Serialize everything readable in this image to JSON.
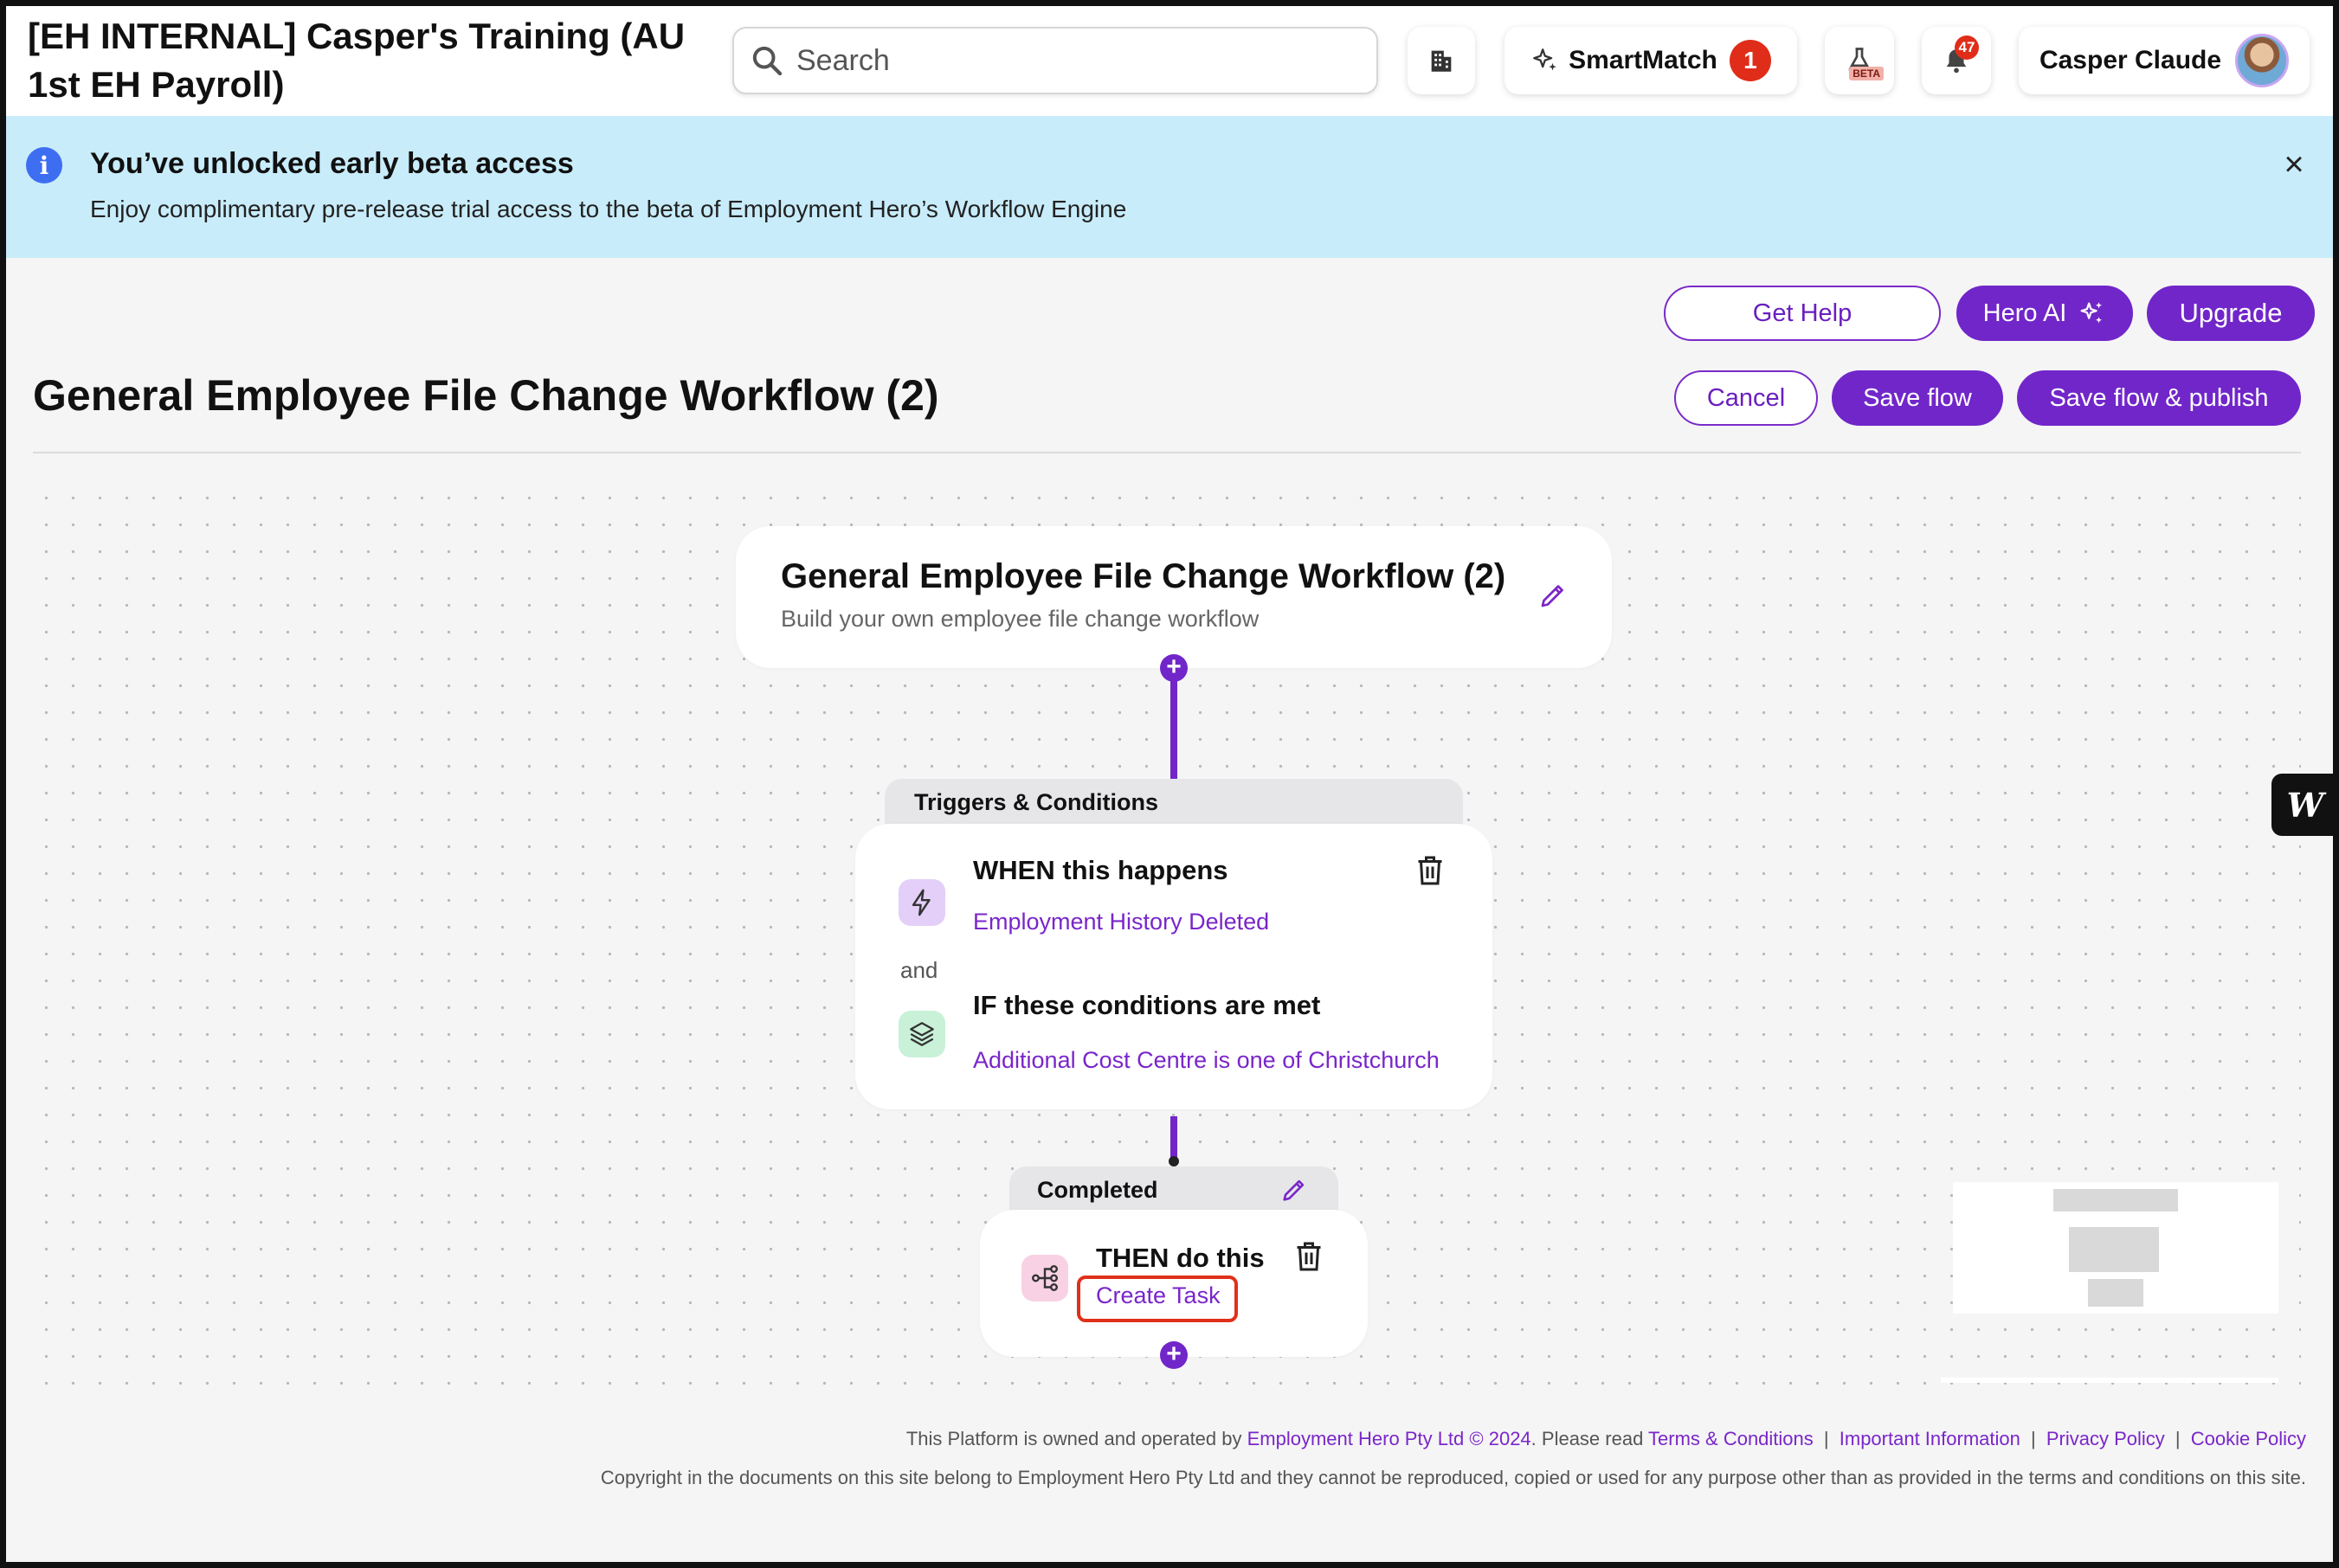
{
  "header": {
    "org_title": "[EH INTERNAL] Casper's Training (AU 1st EH Payroll)",
    "search_placeholder": "Search",
    "smartmatch_label": "SmartMatch",
    "smartmatch_count": "1",
    "beta_tag": "BETA",
    "notification_count": "47",
    "user_name": "Casper Claude"
  },
  "banner": {
    "title": "You’ve unlocked early beta access",
    "text": "Enjoy complimentary pre-release trial access to the beta of Employment Hero’s Workflow Engine",
    "close": "×"
  },
  "actions": {
    "get_help": "Get Help",
    "hero_ai": "Hero AI",
    "upgrade": "Upgrade",
    "cancel": "Cancel",
    "save_flow": "Save flow",
    "save_publish": "Save flow & publish"
  },
  "page": {
    "title": "General Employee File Change Workflow (2)"
  },
  "workflow": {
    "title_card": {
      "title": "General Employee File Change Workflow (2)",
      "subtitle": "Build your own employee file change workflow"
    },
    "triggers": {
      "header": "Triggers & Conditions",
      "when_heading": "WHEN this happens",
      "when_value": "Employment History Deleted",
      "and_label": "and",
      "if_heading": "IF these conditions are met",
      "if_value": "Additional Cost Centre is one of Christchurch"
    },
    "completed": {
      "header": "Completed",
      "then_heading": "THEN do this",
      "then_value": "Create Task"
    },
    "plus": "+"
  },
  "side_widget": "W",
  "footer": {
    "owned_prefix": "This Platform is owned and operated by",
    "company": "Employment Hero Pty Ltd © 2024",
    "read_prefix": ". Please read",
    "terms": "Terms & Conditions",
    "important": "Important Information",
    "privacy": "Privacy Policy",
    "cookie": "Cookie Policy",
    "separator": "|",
    "copyright": "Copyright in the documents on this site belong to Employment Hero Pty Ltd and they cannot be reproduced, copied or used for any purpose other than as provided in the terms and conditions on this site."
  },
  "colors": {
    "brand_purple": "#7126c9",
    "banner_bg": "#c8ecfa",
    "badge_red": "#e02d1a"
  }
}
